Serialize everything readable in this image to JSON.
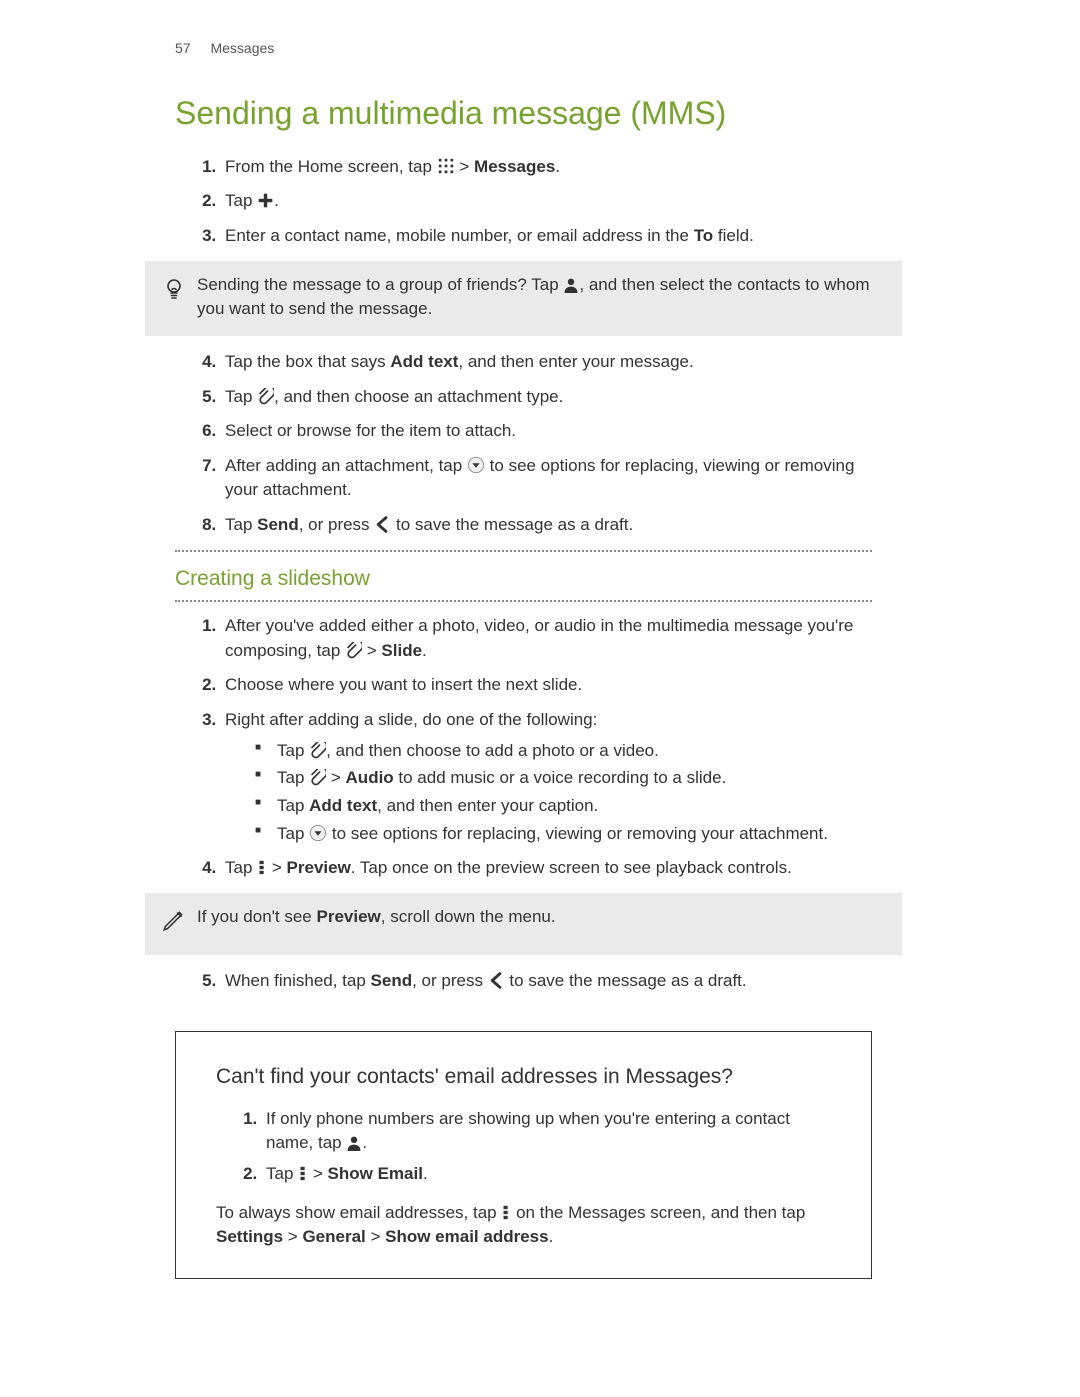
{
  "header": {
    "page_number": "57",
    "section": "Messages"
  },
  "title": "Sending a multimedia message (MMS)",
  "steps1": {
    "s1a": "From the Home screen, tap ",
    "s1b": " > ",
    "s1c": "Messages",
    "s1d": ".",
    "s2a": "Tap ",
    "s2b": ".",
    "s3a": "Enter a contact name, mobile number, or email address in the ",
    "s3b": "To",
    "s3c": " field."
  },
  "tip": {
    "a": "Sending the message to a group of friends? Tap ",
    "b": ", and then select the contacts to whom you want to send the message."
  },
  "steps2": {
    "s4a": "Tap the box that says ",
    "s4b": "Add text",
    "s4c": ", and then enter your message.",
    "s5a": "Tap ",
    "s5b": ", and then choose an attachment type.",
    "s6": "Select or browse for the item to attach.",
    "s7a": "After adding an attachment, tap ",
    "s7b": " to see options for replacing, viewing or removing your attachment.",
    "s8a": "Tap ",
    "s8b": "Send",
    "s8c": ", or press ",
    "s8d": " to save the message as a draft."
  },
  "subtitle": "Creating a slideshow",
  "slide": {
    "s1a": "After you've added either a photo, video, or audio in the multimedia message you're composing, tap ",
    "s1b": " > ",
    "s1c": "Slide",
    "s1d": ".",
    "s2": "Choose where you want to insert the next slide.",
    "s3": "Right after adding a slide, do one of the following:",
    "b1a": "Tap ",
    "b1b": ", and then choose to add a photo or a video.",
    "b2a": "Tap ",
    "b2b": " > ",
    "b2c": "Audio",
    "b2d": " to add music or a voice recording to a slide.",
    "b3a": "Tap ",
    "b3b": "Add text",
    "b3c": ", and then enter your caption.",
    "b4a": "Tap ",
    "b4b": " to see options for replacing, viewing or removing your attachment.",
    "s4a": "Tap ",
    "s4b": " > ",
    "s4c": "Preview",
    "s4d": ". Tap once on the preview screen to see playback controls."
  },
  "note": {
    "a": "If you don't see ",
    "b": "Preview",
    "c": ", scroll down the menu."
  },
  "slide_after": {
    "s5a": "When finished, tap ",
    "s5b": "Send",
    "s5c": ", or press ",
    "s5d": " to save the message as a draft."
  },
  "box": {
    "heading": "Can't find your contacts' email addresses in Messages?",
    "s1a": "If only phone numbers are showing up when you're entering a contact name, tap ",
    "s1b": ".",
    "s2a": "Tap ",
    "s2b": " > ",
    "s2c": "Show Email",
    "s2d": ".",
    "fa": "To always show email addresses, tap ",
    "fb": " on the Messages screen, and then tap ",
    "fc": "Settings",
    "fd": " > ",
    "fe": "General",
    "ff": " > ",
    "fg": "Show email address",
    "fh": "."
  }
}
